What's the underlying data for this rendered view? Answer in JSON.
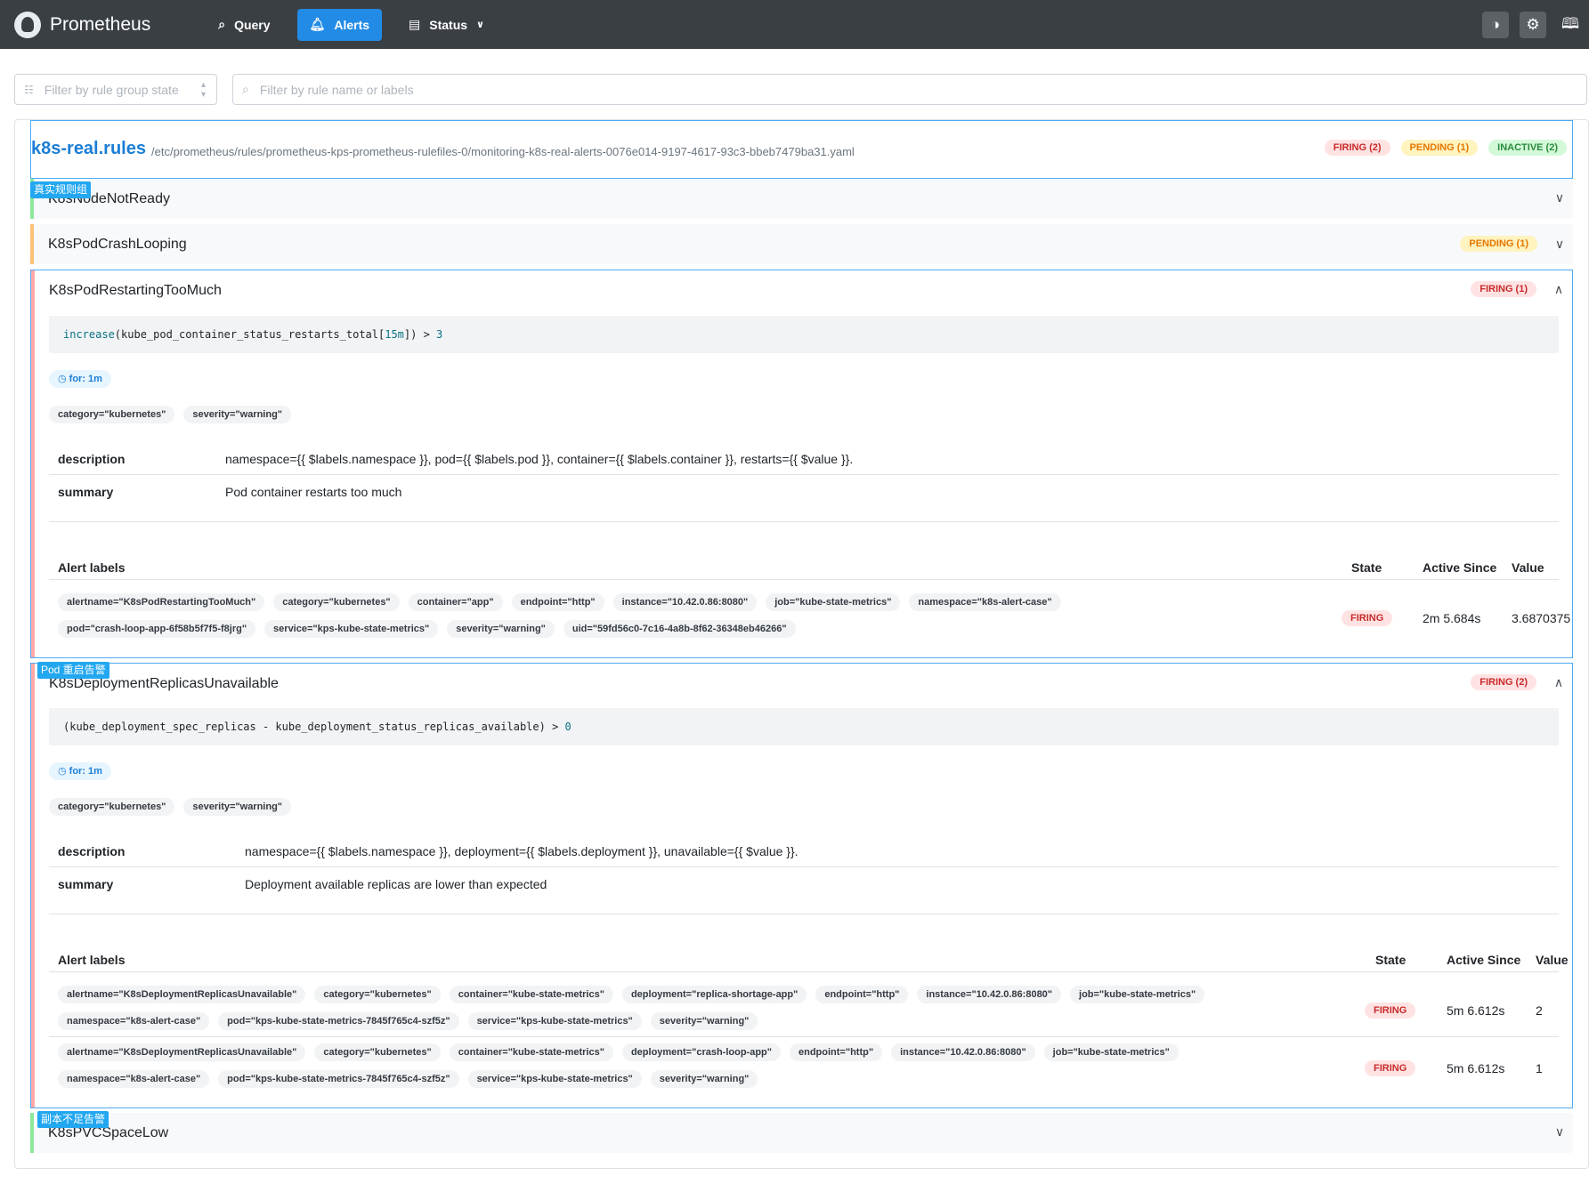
{
  "header": {
    "app_name": "Prometheus",
    "nav": {
      "query": "Query",
      "alerts": "Alerts",
      "status": "Status"
    }
  },
  "filters": {
    "state_placeholder": "Filter by rule group state",
    "rule_placeholder": "Filter by rule name or labels"
  },
  "group": {
    "name": "k8s-real.rules",
    "file": "/etc/prometheus/rules/prometheus-kps-prometheus-rulefiles-0/monitoring-k8s-real-alerts-0076e014-9197-4617-93c3-bbeb7479ba31.yaml",
    "badges": {
      "firing": "FIRING (2)",
      "pending": "PENDING (1)",
      "inactive": "INACTIVE (2)"
    }
  },
  "annotations": {
    "group_tag": "真实规则组",
    "pod_tag": "Pod 重启告警",
    "replica_tag": "副本不足告警"
  },
  "colors": {
    "inactive": "#8ce99a",
    "pending": "#ffc078",
    "firing": "#ffa8a8",
    "accent": "#228be6"
  },
  "rules": {
    "r1": {
      "name": "K8sNodeNotReady"
    },
    "r2": {
      "name": "K8sPodCrashLooping",
      "badge": "PENDING (1)"
    },
    "r3": {
      "name": "K8sPodRestartingTooMuch",
      "badge": "FIRING (1)",
      "expr": {
        "fn": "increase",
        "body": "(kube_pod_container_status_restarts_total[",
        "range": "15m",
        "close": "]) > ",
        "threshold": "3"
      },
      "for": "for: 1m",
      "labels": [
        "category=\"kubernetes\"",
        "severity=\"warning\""
      ],
      "annotations": {
        "description_key": "description",
        "description": "namespace={{ $labels.namespace }}, pod={{ $labels.pod }}, container={{ $labels.container }}, restarts={{ $value }}.",
        "summary_key": "summary",
        "summary": "Pod container restarts too much"
      },
      "table_headers": {
        "labels": "Alert labels",
        "state": "State",
        "active_since": "Active Since",
        "value": "Value"
      },
      "alerts": [
        {
          "labels_line1": [
            "alertname=\"K8sPodRestartingTooMuch\"",
            "category=\"kubernetes\"",
            "container=\"app\"",
            "endpoint=\"http\"",
            "instance=\"10.42.0.86:8080\"",
            "job=\"kube-state-metrics\"",
            "namespace=\"k8s-alert-case\""
          ],
          "labels_line2": [
            "pod=\"crash-loop-app-6f58b5f7f5-f8jrg\"",
            "service=\"kps-kube-state-metrics\"",
            "severity=\"warning\"",
            "uid=\"59fd56c0-7c16-4a8b-8f62-36348eb46266\""
          ],
          "state": "FIRING",
          "active_since": "2m 5.684s",
          "value": "3.6870375"
        }
      ]
    },
    "r4": {
      "name": "K8sDeploymentReplicasUnavailable",
      "badge": "FIRING (2)",
      "expr": {
        "body": "(kube_deployment_spec_replicas - kube_deployment_status_replicas_available) > ",
        "threshold": "0"
      },
      "for": "for: 1m",
      "labels": [
        "category=\"kubernetes\"",
        "severity=\"warning\""
      ],
      "annotations": {
        "description_key": "description",
        "description": "namespace={{ $labels.namespace }}, deployment={{ $labels.deployment }}, unavailable={{ $value }}.",
        "summary_key": "summary",
        "summary": "Deployment available replicas are lower than expected"
      },
      "table_headers": {
        "labels": "Alert labels",
        "state": "State",
        "active_since": "Active Since",
        "value": "Value"
      },
      "alerts": [
        {
          "labels_line1": [
            "alertname=\"K8sDeploymentReplicasUnavailable\"",
            "category=\"kubernetes\"",
            "container=\"kube-state-metrics\"",
            "deployment=\"replica-shortage-app\"",
            "endpoint=\"http\"",
            "instance=\"10.42.0.86:8080\"",
            "job=\"kube-state-metrics\""
          ],
          "labels_line2": [
            "namespace=\"k8s-alert-case\"",
            "pod=\"kps-kube-state-metrics-7845f765c4-szf5z\"",
            "service=\"kps-kube-state-metrics\"",
            "severity=\"warning\""
          ],
          "state": "FIRING",
          "active_since": "5m 6.612s",
          "value": "2"
        },
        {
          "labels_line1": [
            "alertname=\"K8sDeploymentReplicasUnavailable\"",
            "category=\"kubernetes\"",
            "container=\"kube-state-metrics\"",
            "deployment=\"crash-loop-app\"",
            "endpoint=\"http\"",
            "instance=\"10.42.0.86:8080\"",
            "job=\"kube-state-metrics\""
          ],
          "labels_line2": [
            "namespace=\"k8s-alert-case\"",
            "pod=\"kps-kube-state-metrics-7845f765c4-szf5z\"",
            "service=\"kps-kube-state-metrics\"",
            "severity=\"warning\""
          ],
          "state": "FIRING",
          "active_since": "5m 6.612s",
          "value": "1"
        }
      ]
    },
    "r5": {
      "name": "K8sPVCSpaceLow"
    }
  }
}
